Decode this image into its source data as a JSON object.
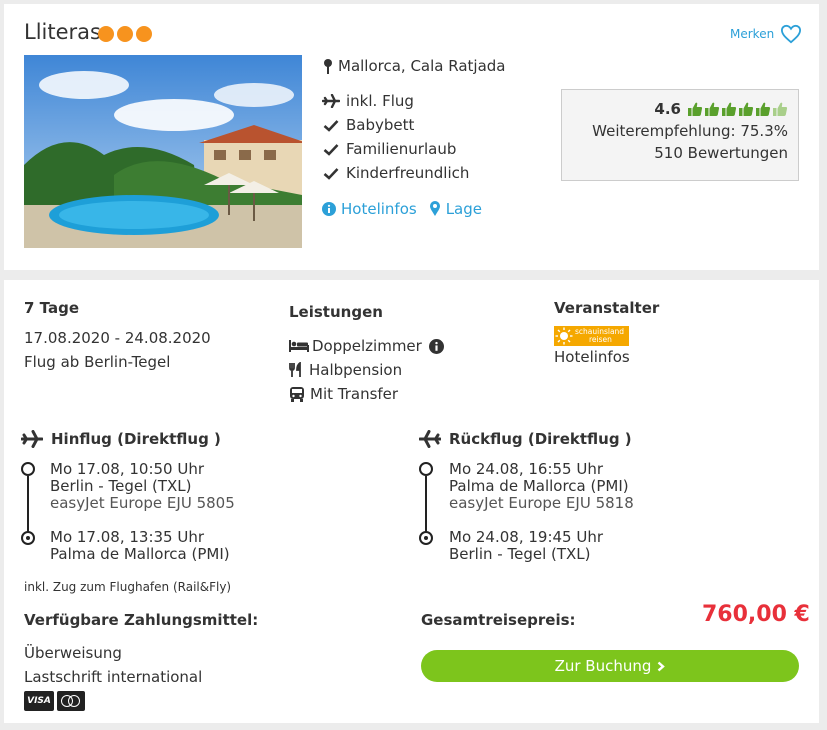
{
  "hotel": {
    "name": "Lliteras",
    "stars": 3,
    "save_label": "Merken",
    "location": "Mallorca, Cala Ratjada",
    "features": [
      "inkl. Flug",
      "Babybett",
      "Familienurlaub",
      "Kinderfreundlich"
    ],
    "info_link": "Hotelinfos",
    "map_link": "Lage"
  },
  "rating": {
    "score": "4.6",
    "thumbs_filled": 5,
    "thumbs_total": 6,
    "recommendation": "Weiterempfehlung: 75.3%",
    "reviews": "510 Bewertungen"
  },
  "trip": {
    "duration": "7 Tage",
    "dates": "17.08.2020 - 24.08.2020",
    "departure": "Flug ab Berlin-Tegel"
  },
  "services": {
    "heading": "Leistungen",
    "items": [
      "Doppelzimmer",
      "Halbpension",
      "Mit Transfer"
    ]
  },
  "operator": {
    "heading": "Veranstalter",
    "logo_text": [
      "schauinsland",
      "reisen"
    ],
    "link": "Hotelinfos"
  },
  "outbound": {
    "title": "Hinflug (Direktflug )",
    "dep_time": "Mo 17.08, 10:50 Uhr",
    "dep_airport": "Berlin - Tegel (TXL)",
    "airline": "easyJet Europe EJU 5805",
    "arr_time": "Mo 17.08, 13:35 Uhr",
    "arr_airport": "Palma de Mallorca (PMI)"
  },
  "return": {
    "title": "Rückflug (Direktflug )",
    "dep_time": "Mo 24.08, 16:55 Uhr",
    "dep_airport": "Palma de Mallorca (PMI)",
    "airline": "easyJet Europe EJU 5818",
    "arr_time": "Mo 24.08, 19:45 Uhr",
    "arr_airport": "Berlin - Tegel (TXL)"
  },
  "rail_note": "inkl. Zug zum Flughafen (Rail&Fly)",
  "payment": {
    "heading": "Verfügbare Zahlungsmittel:",
    "methods": [
      "Überweisung",
      "Lastschrift international"
    ],
    "visa_label": "VISA"
  },
  "total": {
    "label": "Gesamtreisepreis:",
    "price": "760,00 €",
    "book_label": "Zur Buchung"
  },
  "colors": {
    "accent_blue": "#2ca0d8",
    "star_orange": "#f7931e",
    "price_red": "#e8303a",
    "book_green": "#7dc51c",
    "thumb_green": "#5aa02c"
  }
}
